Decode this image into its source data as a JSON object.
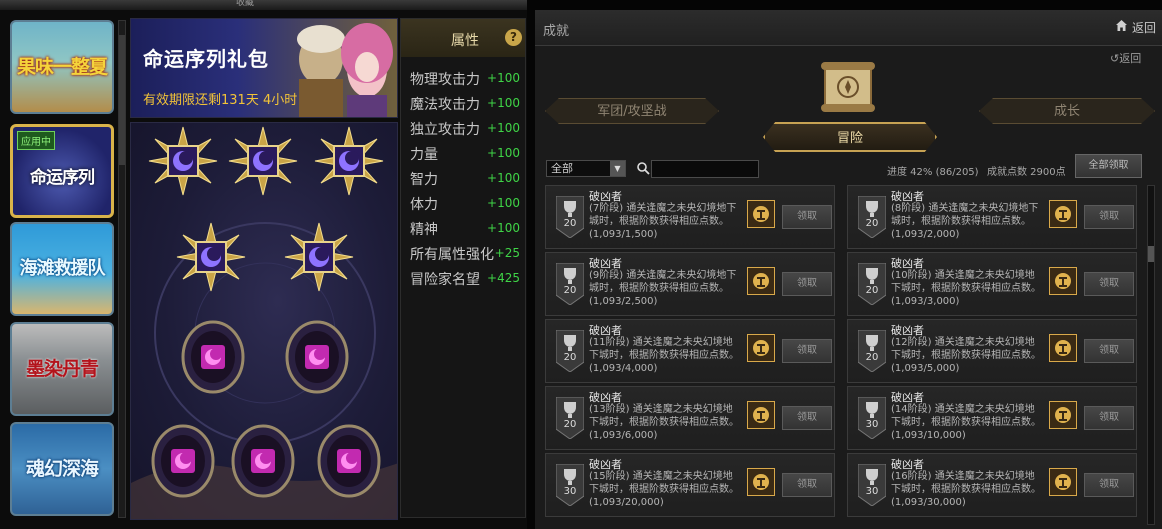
{
  "left_window": {
    "title": "收藏",
    "cards": [
      {
        "label": "果味一整夏"
      },
      {
        "label": "命运序列",
        "badge": "应用中"
      },
      {
        "label": "海滩救援队"
      },
      {
        "label": "墨染丹青"
      },
      {
        "label": "魂幻深海"
      }
    ],
    "banner": {
      "title": "命运序列礼包",
      "subtitle": "有效期限还剩131天 4小时"
    },
    "attributes": {
      "title": "属性",
      "help": "?",
      "rows": [
        {
          "name": "物理攻击力",
          "value": "+100"
        },
        {
          "name": "魔法攻击力",
          "value": "+100"
        },
        {
          "name": "独立攻击力",
          "value": "+100"
        },
        {
          "name": "力量",
          "value": "+100"
        },
        {
          "name": "智力",
          "value": "+100"
        },
        {
          "name": "体力",
          "value": "+100"
        },
        {
          "name": "精神",
          "value": "+100"
        },
        {
          "name": "所有属性强化",
          "value": "+25"
        },
        {
          "name": "冒险家名望",
          "value": "+425"
        }
      ]
    }
  },
  "achievements_window": {
    "title": "成就",
    "back_label": "返回",
    "back_small_label": "返回",
    "tabs": {
      "legion": "军团/攻坚战",
      "adventure": "冒险",
      "growth": "成长"
    },
    "filter": {
      "selected": "全部"
    },
    "search": {
      "value": ""
    },
    "progress_text": "进度  42% (86/205)",
    "points_text": "成就点数 2900点",
    "claim_all_label": "全部领取",
    "items": [
      {
        "name": "破凶者",
        "level": "20",
        "desc": "(7阶段) 通关逢魔之未央幻境地下城时，根据阶数获得相应点数。",
        "progress": "(1,093/1,500)",
        "claim": "领取"
      },
      {
        "name": "破凶者",
        "level": "20",
        "desc": "(8阶段) 通关逢魔之未央幻境地下城时，根据阶数获得相应点数。",
        "progress": "(1,093/2,000)",
        "claim": "领取"
      },
      {
        "name": "破凶者",
        "level": "20",
        "desc": "(9阶段) 通关逢魔之未央幻境地下城时，根据阶数获得相应点数。",
        "progress": "(1,093/2,500)",
        "claim": "领取"
      },
      {
        "name": "破凶者",
        "level": "20",
        "desc": "(10阶段) 通关逢魔之未央幻境地下城时，根据阶数获得相应点数。",
        "progress": "(1,093/3,000)",
        "claim": "领取"
      },
      {
        "name": "破凶者",
        "level": "20",
        "desc": "(11阶段) 通关逢魔之未央幻境地下城时，根据阶数获得相应点数。",
        "progress": "(1,093/4,000)",
        "claim": "领取"
      },
      {
        "name": "破凶者",
        "level": "20",
        "desc": "(12阶段) 通关逢魔之未央幻境地下城时，根据阶数获得相应点数。",
        "progress": "(1,093/5,000)",
        "claim": "领取"
      },
      {
        "name": "破凶者",
        "level": "20",
        "desc": "(13阶段) 通关逢魔之未央幻境地下城时，根据阶数获得相应点数。",
        "progress": "(1,093/6,000)",
        "claim": "领取"
      },
      {
        "name": "破凶者",
        "level": "30",
        "desc": "(14阶段) 通关逢魔之未央幻境地下城时，根据阶数获得相应点数。",
        "progress": "(1,093/10,000)",
        "claim": "领取"
      },
      {
        "name": "破凶者",
        "level": "30",
        "desc": "(15阶段) 通关逢魔之未央幻境地下城时，根据阶数获得相应点数。",
        "progress": "(1,093/20,000)",
        "claim": "领取"
      },
      {
        "name": "破凶者",
        "level": "30",
        "desc": "(16阶段) 通关逢魔之未央幻境地下城时，根据阶数获得相应点数。",
        "progress": "(1,093/30,000)",
        "claim": "领取"
      }
    ]
  }
}
